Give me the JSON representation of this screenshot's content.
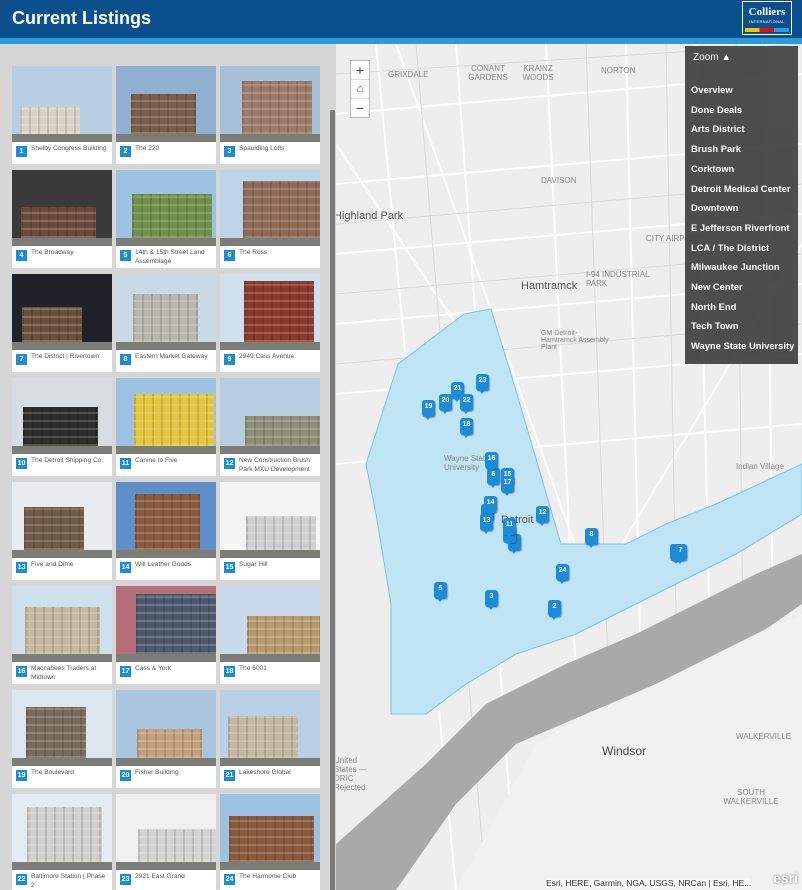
{
  "header": {
    "title": "Current Listings",
    "logo_text": "Colliers",
    "logo_sub": "INTERNATIONAL"
  },
  "listings": [
    {
      "num": "1",
      "name": "Shelby Congress Building"
    },
    {
      "num": "2",
      "name": "The 220"
    },
    {
      "num": "3",
      "name": "Spaulding Lofts"
    },
    {
      "num": "4",
      "name": "The Broadway"
    },
    {
      "num": "5",
      "name": "14th & 15th Street Land Assemblage"
    },
    {
      "num": "6",
      "name": "The Ross"
    },
    {
      "num": "7",
      "name": "The District | Rivertown"
    },
    {
      "num": "8",
      "name": "Eastern Market Gateway"
    },
    {
      "num": "9",
      "name": "2949 Cass Avenue"
    },
    {
      "num": "10",
      "name": "The Detroit Shipping Co."
    },
    {
      "num": "11",
      "name": "Canine to Five"
    },
    {
      "num": "12",
      "name": "New Construction Brush Park MXU Development"
    },
    {
      "num": "13",
      "name": "Five and Dime"
    },
    {
      "num": "14",
      "name": "Will Leather Goods"
    },
    {
      "num": "15",
      "name": "Sugar Hill"
    },
    {
      "num": "16",
      "name": "Maccabees Traders at Midtown"
    },
    {
      "num": "17",
      "name": "Cass & York"
    },
    {
      "num": "18",
      "name": "The 6001"
    },
    {
      "num": "19",
      "name": "The Boulevard"
    },
    {
      "num": "20",
      "name": "Fisher Building"
    },
    {
      "num": "21",
      "name": "Lakeshore Global"
    },
    {
      "num": "22",
      "name": "Baltimore Station | Phase 2"
    },
    {
      "num": "23",
      "name": "2921 East Grand"
    },
    {
      "num": "24",
      "name": "The Harmonie Club"
    }
  ],
  "map": {
    "zoom_in": "+",
    "zoom_out": "−",
    "zoom_menu": {
      "title": "Zoom ▲",
      "items": [
        "Overview",
        "Done Deals",
        "Arts District",
        "Brush Park",
        "Corktown",
        "Detroit Medical Center",
        "Downtown",
        "E Jefferson Riverfront",
        "LCA / The District",
        "Milwaukee Junction",
        "New Center",
        "North End",
        "Tech Town",
        "Wayne State University"
      ]
    },
    "labels": {
      "highland_park": "Highland Park",
      "hamtramck": "Hamtramck",
      "windsor": "Windsor",
      "detroit": "Detroit",
      "wayne_state": "Wayne State University",
      "city_airport": "CITY AIRPORT",
      "industrial_park": "I-94 INDUSTRIAL PARK",
      "gm_plant": "GM Detroit-Hamtramck Assembly Plant",
      "davison": "DAVISON",
      "norton": "NORTON",
      "grixdale": "GRIXDALE",
      "krainz": "KRAINZ WOODS",
      "conant": "CONANT GARDENS",
      "walkerville": "WALKERVILLE",
      "south_walkerville": "SOUTH WALKERVILLE",
      "indian_village": "Indian Village",
      "united_states": "United States — DRIC Rejected"
    },
    "attribution": "Esri, HERE, Garmin, NGA, USGS, NRCan | Esri, HE...",
    "esri_logo": "esri",
    "markers": [
      "1",
      "2",
      "3",
      "4",
      "5",
      "6",
      "7",
      "8",
      "9",
      "10",
      "11",
      "12",
      "13",
      "14",
      "15",
      "16",
      "17",
      "18",
      "19",
      "20",
      "21",
      "22",
      "23",
      "24"
    ]
  },
  "colors": {
    "header": "#0b4f8c",
    "stripe": "#2b9be0",
    "marker": "#1a8cd8",
    "area": "#bfe4f4"
  },
  "icons": {
    "home": "home-icon"
  }
}
